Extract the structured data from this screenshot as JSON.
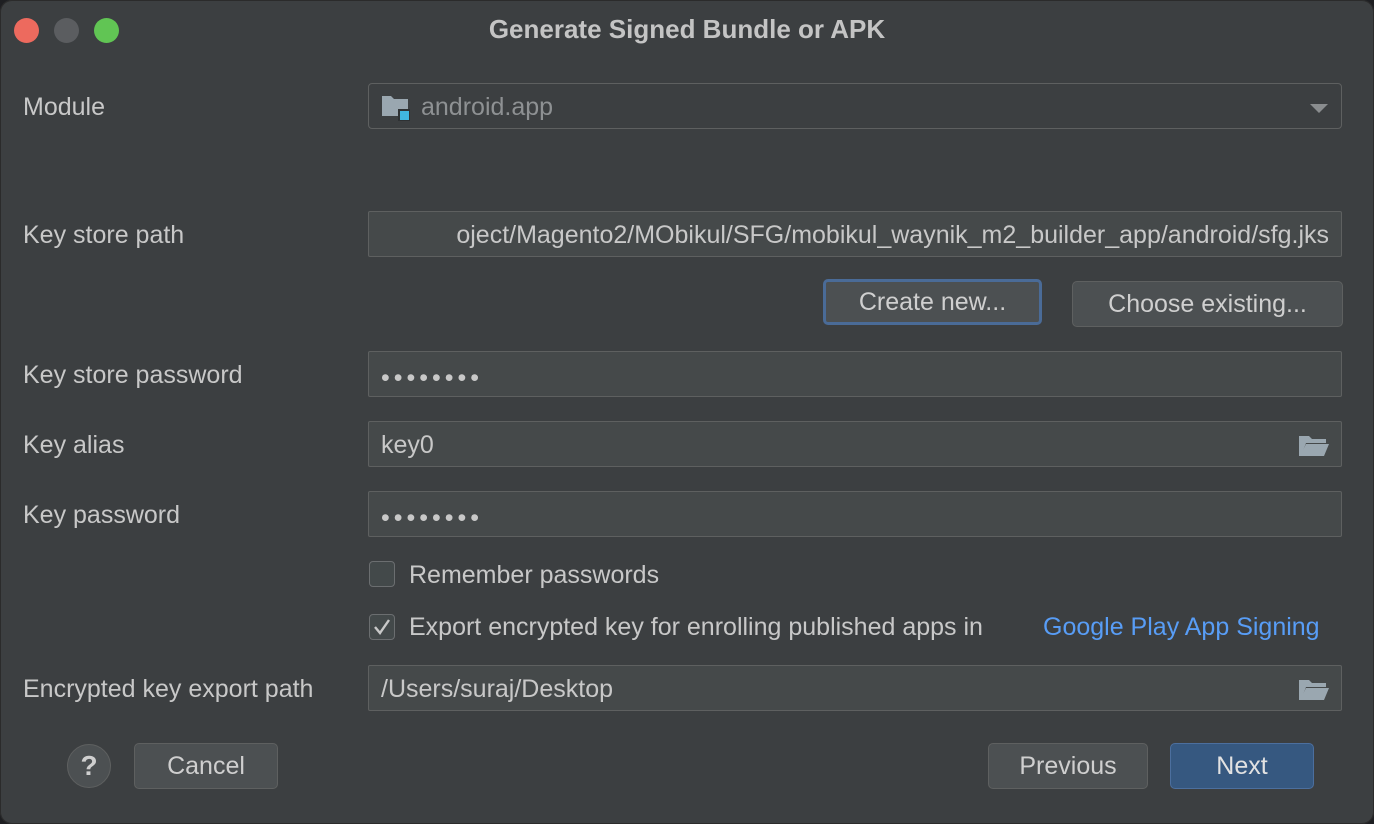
{
  "window": {
    "title": "Generate Signed Bundle or APK"
  },
  "module": {
    "label": "Module",
    "value": "android.app"
  },
  "keystore": {
    "path_label": "Key store path",
    "path_value": "oject/Magento2/MObikul/SFG/mobikul_waynik_m2_builder_app/android/sfg.jks",
    "create_new": "Create new...",
    "choose_existing": "Choose existing...",
    "password_label": "Key store password",
    "password_value": "••••••••"
  },
  "key": {
    "alias_label": "Key alias",
    "alias_value": "key0",
    "password_label": "Key password",
    "password_value": "••••••••"
  },
  "options": {
    "remember_label": "Remember passwords",
    "remember_checked": false,
    "export_label": "Export encrypted key for enrolling published apps in",
    "export_link": "Google Play App Signing",
    "export_checked": true
  },
  "export": {
    "path_label": "Encrypted key export path",
    "path_value": "/Users/suraj/Desktop"
  },
  "footer": {
    "help": "?",
    "cancel": "Cancel",
    "previous": "Previous",
    "next": "Next"
  },
  "colors": {
    "background": "#3c3f41",
    "field": "#45494a",
    "accent": "#365880",
    "link": "#589df6"
  }
}
